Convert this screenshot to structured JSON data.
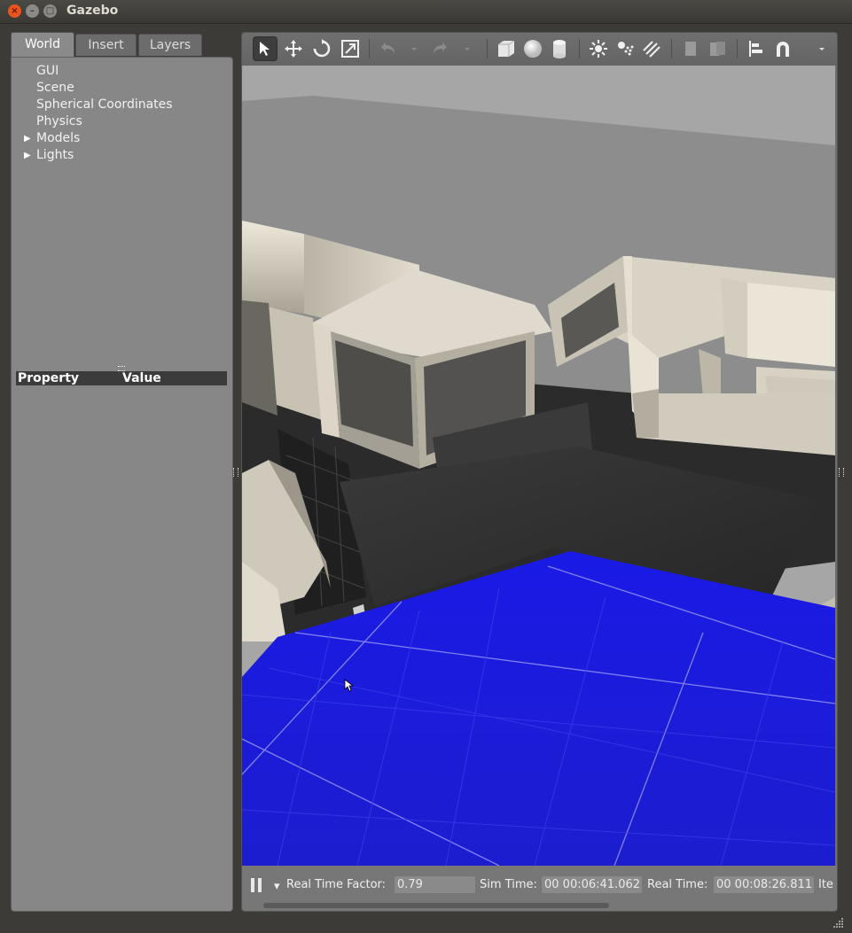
{
  "window": {
    "title": "Gazebo",
    "close_glyph": "×",
    "min_glyph": "–",
    "max_glyph": "□"
  },
  "left_panel": {
    "tabs": [
      {
        "label": "World",
        "active": true
      },
      {
        "label": "Insert",
        "active": false
      },
      {
        "label": "Layers",
        "active": false
      }
    ],
    "tree": [
      {
        "label": "GUI",
        "expandable": false
      },
      {
        "label": "Scene",
        "expandable": false
      },
      {
        "label": "Spherical Coordinates",
        "expandable": false
      },
      {
        "label": "Physics",
        "expandable": false
      },
      {
        "label": "Models",
        "expandable": true
      },
      {
        "label": "Lights",
        "expandable": true
      }
    ],
    "property_table": {
      "col_property": "Property",
      "col_value": "Value"
    }
  },
  "toolbar": {
    "tools": [
      {
        "name": "select-mode-icon",
        "selected": true
      },
      {
        "name": "translate-mode-icon"
      },
      {
        "name": "rotate-mode-icon"
      },
      {
        "name": "scale-mode-icon"
      },
      {
        "name": "undo-icon"
      },
      {
        "name": "undo-history-dropdown-icon"
      },
      {
        "name": "redo-icon"
      },
      {
        "name": "redo-history-dropdown-icon"
      },
      {
        "name": "box-shape-icon"
      },
      {
        "name": "sphere-shape-icon"
      },
      {
        "name": "cylinder-shape-icon"
      },
      {
        "name": "point-light-icon"
      },
      {
        "name": "spot-light-icon"
      },
      {
        "name": "directional-light-icon"
      },
      {
        "name": "copy-icon"
      },
      {
        "name": "paste-icon"
      },
      {
        "name": "align-icon"
      },
      {
        "name": "snap-icon"
      },
      {
        "name": "more-tools-icon"
      }
    ]
  },
  "status_bar": {
    "real_time_factor_label": "Real Time Factor:",
    "real_time_factor_value": "0.79",
    "sim_time_label": "Sim Time:",
    "sim_time_value": "00 00:06:41.062",
    "real_time_label": "Real Time:",
    "real_time_value": "00 00:08:26.811",
    "iterations_label": "Ite"
  },
  "colors": {
    "floor": "#1c1ce0",
    "walls": "#d8d2c4",
    "sky": "#a9a9a9",
    "accent_close": "#e95420"
  }
}
